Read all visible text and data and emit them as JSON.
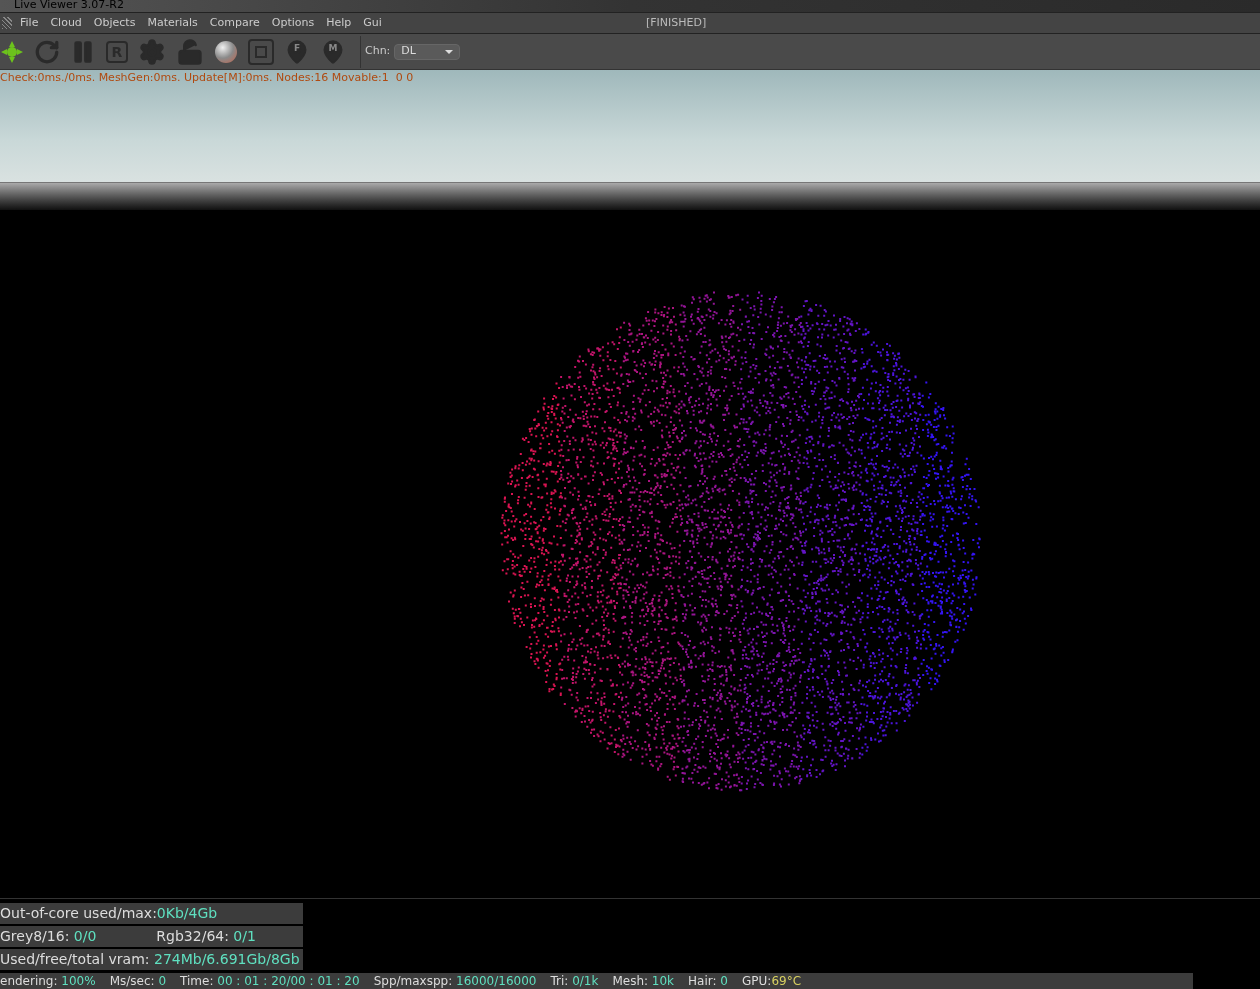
{
  "window": {
    "title": "Live Viewer 3.07-R2",
    "status": "[FINISHED]"
  },
  "menu": [
    "File",
    "Cloud",
    "Objects",
    "Materials",
    "Compare",
    "Options",
    "Help",
    "Gui"
  ],
  "toolbar": [
    {
      "kind": "logo"
    },
    {
      "kind": "restart"
    },
    {
      "kind": "pause"
    },
    {
      "kind": "letter-box",
      "letter": "R"
    },
    {
      "kind": "gear"
    },
    {
      "kind": "lock"
    },
    {
      "kind": "sphere"
    },
    {
      "kind": "region"
    },
    {
      "kind": "pin",
      "letter": "F"
    },
    {
      "kind": "pin",
      "letter": "M"
    }
  ],
  "channel": {
    "label": "Chn:",
    "value": "DL"
  },
  "viewport": {
    "info": "Check:0ms./0ms. MeshGen:0ms. Update[M]:0ms. Nodes:16 Movable:1  0 0"
  },
  "stats": [
    [
      {
        "label": "Out-of-core used/max:",
        "value": "0Kb/4Gb"
      }
    ],
    [
      {
        "label": "Grey8/16: ",
        "value": "0/0"
      },
      {
        "label": "Rgb32/64: ",
        "value": "0/1"
      }
    ],
    [
      {
        "label": "Used/free/total vram: ",
        "value": "274Mb/6.691Gb/8Gb"
      }
    ]
  ],
  "status_bar": [
    {
      "label": "endering: ",
      "value": "100%"
    },
    {
      "label": "Ms/sec: ",
      "value": "0"
    },
    {
      "label": "Time: ",
      "value": "00 : 01 : 20/00 : 01 : 20"
    },
    {
      "label": "Spp/maxspp: ",
      "value": "16000/16000"
    },
    {
      "label": "Tri: ",
      "value": "0/1k"
    },
    {
      "label": "Mesh: ",
      "value": "10k"
    },
    {
      "label": "Hair: ",
      "value": "0"
    },
    {
      "label": "GPU:",
      "value": "69°C"
    }
  ]
}
